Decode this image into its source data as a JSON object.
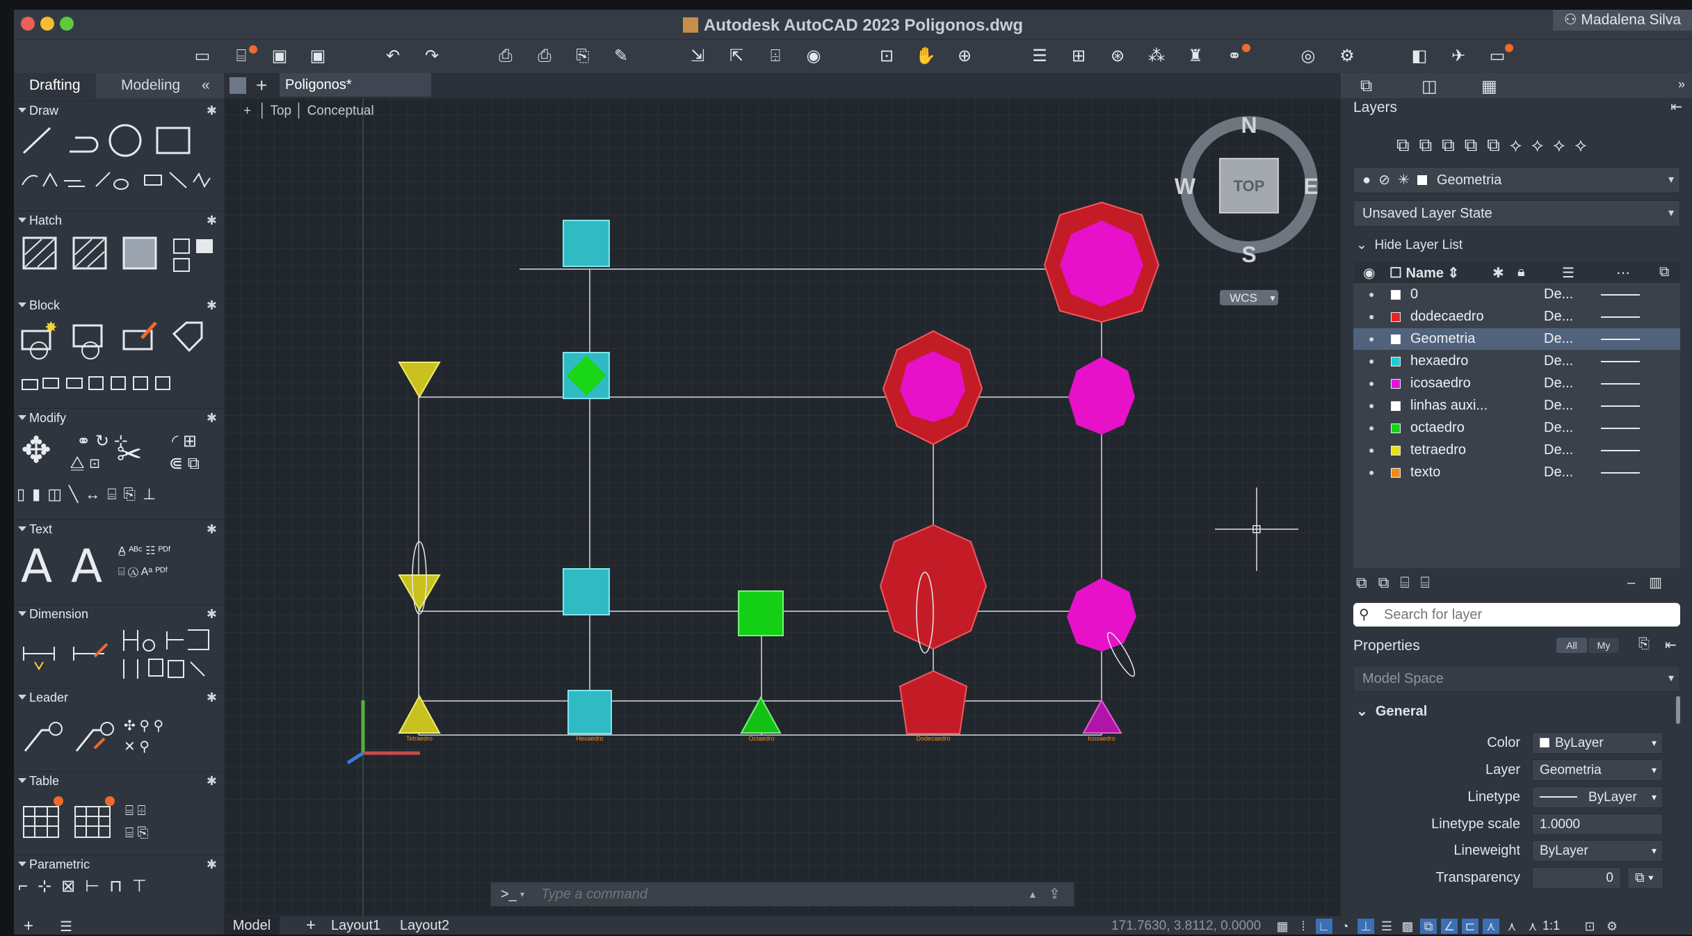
{
  "window": {
    "title": "Autodesk AutoCAD 2023    Poligonos.dwg",
    "user": "Madalena Silva"
  },
  "left_panel": {
    "tabs": [
      "Drafting",
      "Modeling"
    ],
    "collapse_glyph": "«",
    "sections": [
      "Draw",
      "Hatch",
      "Block",
      "Modify",
      "Text",
      "Dimension",
      "Leader",
      "Table",
      "Parametric"
    ]
  },
  "drawing": {
    "file_tab": "Poligonos*",
    "viewport_controls": [
      "+",
      "Top",
      "Conceptual"
    ],
    "viewcube": {
      "top": "TOP",
      "n": "N",
      "s": "S",
      "e": "E",
      "w": "W",
      "wcs": "WCS"
    },
    "object_labels": [
      "Tetraedro",
      "Hexaedro",
      "Octaedro",
      "Dodecaedro",
      "Icosaedro"
    ],
    "colors": {
      "tetraedro": "#d9cf2a",
      "hexaedro": "#38c9d1",
      "octaedro": "#14d614",
      "dodecaedro": "#d8212b",
      "icosaedro": "#e60fd8",
      "label": "#f28c1e"
    }
  },
  "command": {
    "prompt": ">_",
    "placeholder": "Type a command"
  },
  "layers": {
    "title": "Layers",
    "current_layer": "Geometria",
    "layer_state": "Unsaved Layer State",
    "hide_list": "Hide Layer List",
    "name_header": "Name",
    "rows": [
      {
        "name": "0",
        "color": "#ffffff",
        "desc": "De..."
      },
      {
        "name": "dodecaedro",
        "color": "#e8231e",
        "desc": "De..."
      },
      {
        "name": "Geometria",
        "color": "#ffffff",
        "desc": "De..."
      },
      {
        "name": "hexaedro",
        "color": "#22cbd6",
        "desc": "De..."
      },
      {
        "name": "icosaedro",
        "color": "#e114dc",
        "desc": "De..."
      },
      {
        "name": "linhas auxi...",
        "color": "#ffffff",
        "desc": "De..."
      },
      {
        "name": "octaedro",
        "color": "#18d318",
        "desc": "De..."
      },
      {
        "name": "tetraedro",
        "color": "#e6e114",
        "desc": "De..."
      },
      {
        "name": "texto",
        "color": "#f08a1c",
        "desc": "De..."
      }
    ],
    "search_placeholder": "Search for layer"
  },
  "properties": {
    "title": "Properties",
    "filter_all": "All",
    "filter_my": "My",
    "space": "Model Space",
    "group": "General",
    "rows": [
      {
        "label": "Color",
        "value": "ByLayer"
      },
      {
        "label": "Layer",
        "value": "Geometria"
      },
      {
        "label": "Linetype",
        "value": "ByLayer"
      },
      {
        "label": "Linetype scale",
        "value": "1.0000"
      },
      {
        "label": "Lineweight",
        "value": "ByLayer"
      },
      {
        "label": "Transparency",
        "value": "0"
      }
    ]
  },
  "status": {
    "layout_tabs": [
      "Model",
      "Layout1",
      "Layout2"
    ],
    "coordinates": "171.7630, 3.8112, 0.0000",
    "scale": "1:1"
  }
}
